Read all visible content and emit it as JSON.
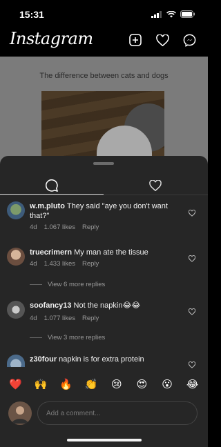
{
  "status": {
    "time": "15:31"
  },
  "header": {
    "logo": "Instagram"
  },
  "post": {
    "caption": "The difference between cats and dogs"
  },
  "comments": [
    {
      "user": "w.m.pluto",
      "text": "They said \"aye you don't want that?\"",
      "age": "4d",
      "likes": "1.067 likes",
      "reply": "Reply"
    },
    {
      "user": "truecrimern",
      "text": "My man ate the tissue",
      "age": "4d",
      "likes": "1.433 likes",
      "reply": "Reply",
      "more_replies": "View 6 more replies"
    },
    {
      "user": "soofancy13",
      "text": "Not the napkin😂😂",
      "age": "4d",
      "likes": "1.077 likes",
      "reply": "Reply",
      "more_replies": "View 3 more replies"
    },
    {
      "user": "z30four",
      "text": "napkin is for extra protein"
    }
  ],
  "emojis": [
    "❤️",
    "🙌",
    "🔥",
    "👏",
    "😢",
    "😍",
    "😮",
    "😂"
  ],
  "input": {
    "placeholder": "Add a comment..."
  },
  "icons": {
    "header": [
      "add-post-icon",
      "heart-icon",
      "messenger-icon"
    ],
    "tabs": [
      "comment-icon",
      "heart-icon"
    ]
  }
}
